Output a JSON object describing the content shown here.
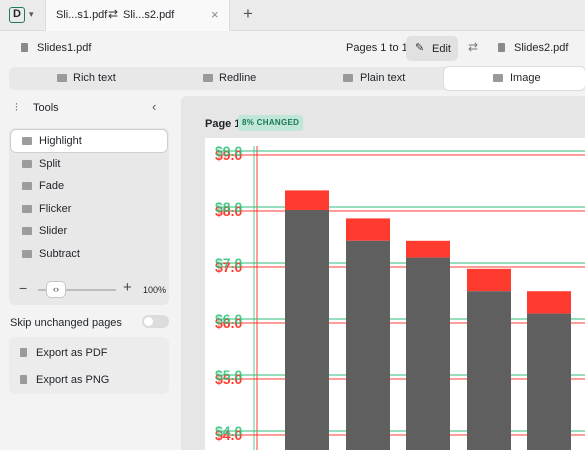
{
  "titlebar": {
    "logo_letter": "D",
    "tab_left": "Sli...s1.pdf",
    "tab_right": "Sli...s2.pdf",
    "swap_glyph": "⇄",
    "close_glyph": "×",
    "new_tab_glyph": "+"
  },
  "header": {
    "left_file": "Slides1.pdf",
    "pages": "Pages 1 to 1",
    "edit_label": "Edit",
    "right_file": "Slides2.pdf"
  },
  "modes": [
    {
      "label": "Rich text",
      "icon": "rich-text-icon"
    },
    {
      "label": "Redline",
      "icon": "redline-icon"
    },
    {
      "label": "Plain text",
      "icon": "plain-text-icon"
    },
    {
      "label": "Image",
      "icon": "image-icon"
    }
  ],
  "sidebar": {
    "title": "Tools",
    "tools": [
      {
        "label": "Highlight",
        "icon": "highlight-icon"
      },
      {
        "label": "Split",
        "icon": "split-icon"
      },
      {
        "label": "Fade",
        "icon": "fade-icon"
      },
      {
        "label": "Flicker",
        "icon": "flicker-icon"
      },
      {
        "label": "Slider",
        "icon": "slider-icon"
      },
      {
        "label": "Subtract",
        "icon": "subtract-icon"
      }
    ],
    "zoom_value": "100%",
    "skip_label": "Skip unchanged pages",
    "skip_enabled": false,
    "exports": [
      {
        "label": "Export as PDF",
        "icon": "pdf-icon"
      },
      {
        "label": "Export as PNG",
        "icon": "png-icon"
      }
    ]
  },
  "main": {
    "page_label": "Page 1",
    "changed_badge": "8% CHANGED"
  },
  "colors": {
    "added": "#2fbf7a",
    "removed": "#ff3b30",
    "bar": "#5f5f5f",
    "badge_bg": "#bfe6d7",
    "badge_text": "#1b7a55"
  },
  "chart_data": {
    "type": "bar",
    "y_tick_labels": [
      "$9.0",
      "$8.0",
      "$7.0",
      "$6.0",
      "$5.0",
      "$4.0"
    ],
    "y_ticks": [
      9,
      8,
      7,
      6,
      5,
      4
    ],
    "ylim": [
      3.8,
      9.2
    ],
    "series": [
      {
        "values": [
          8.0,
          7.45,
          7.15,
          6.55,
          6.15
        ]
      },
      {
        "values": [
          8.35,
          7.85,
          7.45,
          6.95,
          6.55
        ]
      }
    ]
  }
}
